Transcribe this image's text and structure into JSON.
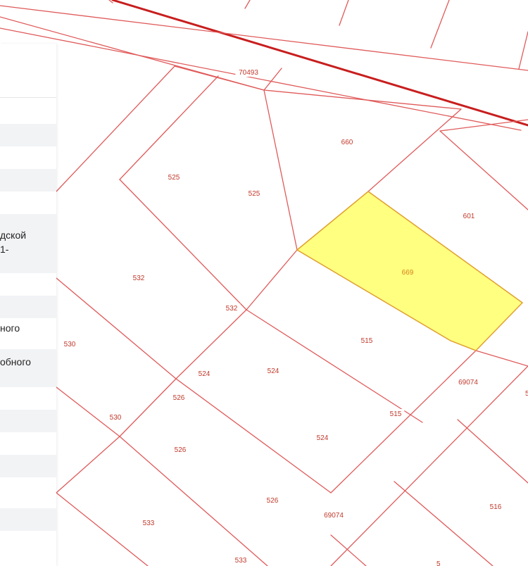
{
  "map": {
    "colors": {
      "background": "#ffffff",
      "parcel_border": "#e05a5a",
      "major_line": "#c81e1e",
      "highlight_fill": "#ffff80",
      "highlight_border": "#e0a030",
      "label_text": "#c0392b",
      "highlight_label_text": "#d4801a"
    },
    "highlighted_parcel": "669",
    "parcel_labels": [
      "70493",
      "660",
      "525",
      "525",
      "601",
      "669",
      "532",
      "532",
      "530",
      "515",
      "524",
      "524",
      "69074",
      "526",
      "530",
      "515",
      "524",
      "526",
      "526",
      "69074",
      "516",
      "533",
      "533"
    ],
    "cut_off_labels": [
      "5",
      "5"
    ]
  },
  "panel": {
    "text_fragments": [
      "дской",
      "1-",
      "ного",
      "обного"
    ]
  }
}
